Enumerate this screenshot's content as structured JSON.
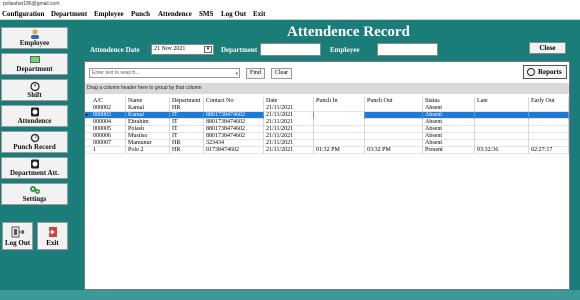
{
  "window": {
    "title": "poliashar186@gmail.com"
  },
  "menu": [
    "Configuration",
    "Department",
    "Employee",
    "Punch",
    "Attendence",
    "SMS",
    "Log Out",
    "Exit"
  ],
  "sidebar": {
    "items": [
      {
        "label": "Employee",
        "icon": "person-icon"
      },
      {
        "label": "Department",
        "icon": "department-icon"
      },
      {
        "label": "Shift",
        "icon": "stopwatch-icon"
      },
      {
        "label": "Attendence",
        "icon": "clock-icon"
      },
      {
        "label": "Punch Record",
        "icon": "punch-clock-icon"
      },
      {
        "label": "Department Att.",
        "icon": "alarm-clock-icon"
      },
      {
        "label": "Settings",
        "icon": "gears-icon"
      }
    ],
    "logout_label": "Log Out",
    "exit_label": "Exit"
  },
  "page": {
    "title": "Attendence Record",
    "date_label": "Attendence Date",
    "date_value": "21 Nov 2021",
    "department_label": "Department",
    "employee_label": "Employee",
    "close_label": "Close",
    "reports_label": "Reports"
  },
  "search": {
    "placeholder": "Enter text to search...",
    "find_label": "Find",
    "clear_label": "Clear"
  },
  "group_hint": "Drag a column header here to group by that column",
  "table": {
    "columns": [
      "A/C",
      "Name",
      "Department",
      "Contact No",
      "Date",
      "Punch In",
      "Punch Out",
      "Status",
      "Late",
      "Early Out"
    ],
    "rows": [
      [
        "000002",
        "Kamal",
        "HR",
        "",
        "21/11/2021",
        "",
        "",
        "Absent",
        "",
        ""
      ],
      [
        "000003",
        "Kamal",
        "IT",
        "8801738474602",
        "21/11/2021",
        "",
        "",
        "Absent",
        "",
        ""
      ],
      [
        "000004",
        "Ebrahim",
        "IT",
        "8801738474602",
        "21/11/2021",
        "",
        "",
        "Absent",
        "",
        ""
      ],
      [
        "000005",
        "Polash",
        "IT",
        "8801738474602",
        "21/11/2021",
        "",
        "",
        "Absent",
        "",
        ""
      ],
      [
        "000006",
        "Mustiso",
        "IT",
        "8801738474602",
        "21/11/2021",
        "",
        "",
        "Absent",
        "",
        ""
      ],
      [
        "000007",
        "Mamunur",
        "HR",
        "323434",
        "21/11/2021",
        "",
        "",
        "Absent",
        "",
        ""
      ],
      [
        "1",
        "Polo 2",
        "HR",
        "01738474602",
        "21/11/2021",
        "01:32 PM",
        "03:32 PM",
        "Present",
        "03:32:36",
        "02:27:17"
      ]
    ],
    "selected_row": 1
  },
  "colors": {
    "accent": "#1a7d7a",
    "selection": "#1f7ad3"
  }
}
